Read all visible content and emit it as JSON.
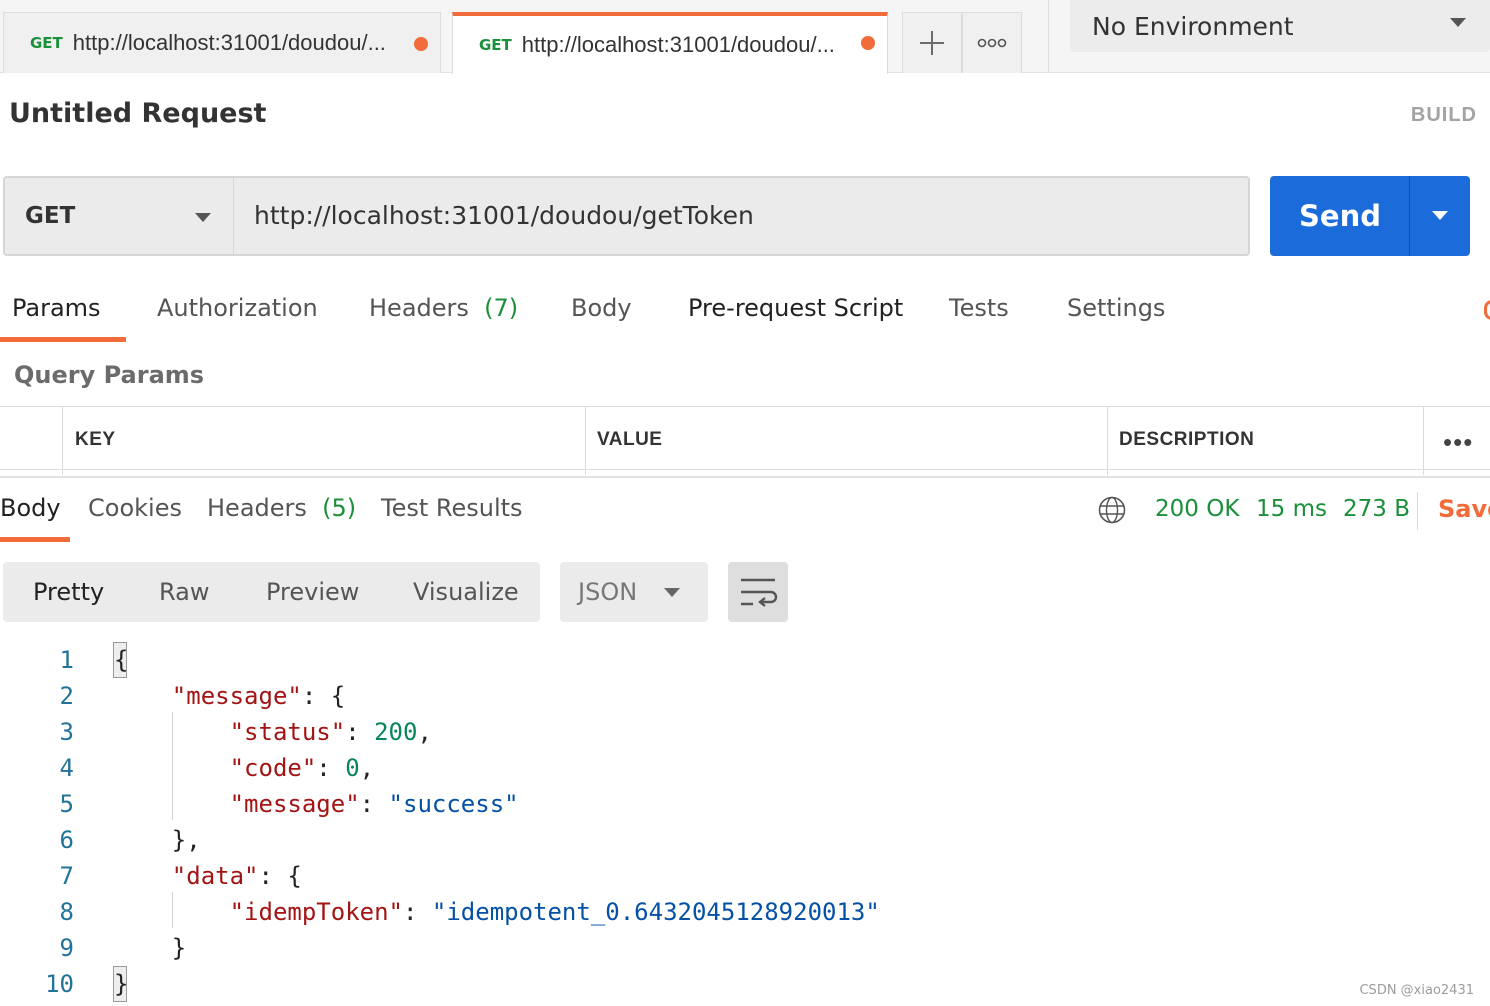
{
  "tabs": [
    {
      "method": "GET",
      "url": "http://localhost:31001/doudou/..."
    },
    {
      "method": "GET",
      "url": "http://localhost:31001/doudou/..."
    }
  ],
  "tab_actions": {
    "add": "+",
    "more": "ooo"
  },
  "environment": {
    "label": "No Environment"
  },
  "request": {
    "title": "Untitled Request",
    "build_label": "BUILD",
    "method": "GET",
    "url": "http://localhost:31001/doudou/getToken",
    "send_label": "Send"
  },
  "request_tabs": {
    "params": "Params",
    "authorization": "Authorization",
    "headers": "Headers",
    "headers_count": "(7)",
    "body": "Body",
    "pre_request": "Pre-request Script",
    "tests": "Tests",
    "settings": "Settings"
  },
  "query_params": {
    "title": "Query Params",
    "columns": [
      "KEY",
      "VALUE",
      "DESCRIPTION"
    ],
    "more": "•••"
  },
  "response_tabs": {
    "body": "Body",
    "cookies": "Cookies",
    "headers": "Headers",
    "headers_count": "(5)",
    "test_results": "Test Results"
  },
  "response_status": {
    "status": "200 OK",
    "time": "15 ms",
    "size": "273 B",
    "save_label": "Save"
  },
  "format": {
    "modes": [
      "Pretty",
      "Raw",
      "Preview",
      "Visualize"
    ],
    "language": "JSON"
  },
  "code": {
    "line_numbers": [
      "1",
      "2",
      "3",
      "4",
      "5",
      "6",
      "7",
      "8",
      "9",
      "10"
    ],
    "message_key": "\"message\"",
    "status_key": "\"status\"",
    "status_val": "200",
    "code_key": "\"code\"",
    "code_val": "0",
    "msg_key": "\"message\"",
    "msg_val": "\"success\"",
    "data_key": "\"data\"",
    "token_key": "\"idempToken\"",
    "token_val": "\"idempotent_0.6432045128920013\""
  },
  "watermark": "CSDN @xiao2431",
  "colors": {
    "accent": "#f26b3a",
    "send": "#1c6bdb",
    "status_green": "#1b8f3a"
  }
}
